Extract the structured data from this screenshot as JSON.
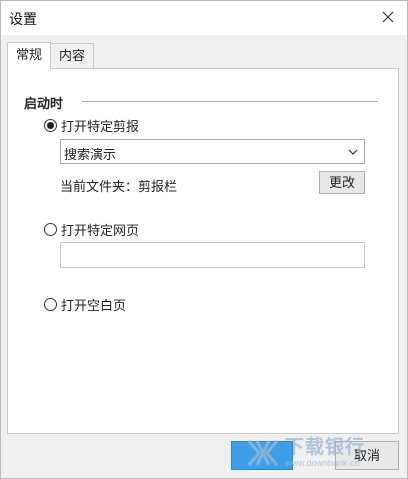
{
  "window": {
    "title": "设置"
  },
  "tabs": [
    {
      "label": "常规",
      "active": true
    },
    {
      "label": "内容",
      "active": false
    }
  ],
  "startup": {
    "section_title": "启动时",
    "options": [
      {
        "label": "打开特定剪报",
        "checked": true
      },
      {
        "label": "打开特定网页",
        "checked": false
      },
      {
        "label": "打开空白页",
        "checked": false
      }
    ],
    "clip_select": {
      "value": "搜索演示"
    },
    "folder_label": "当前文件夹：剪报栏",
    "change_button": "更改",
    "url_input": {
      "value": "",
      "placeholder": ""
    }
  },
  "footer": {
    "cancel_button": "取消"
  },
  "watermark": {
    "main": "下载银行",
    "sub": "www.downbank.cn"
  },
  "colors": {
    "ok_button": "#3d9fe8",
    "dialog_bg": "#f0f0f0",
    "panel_bg": "#ffffff"
  },
  "icons": {
    "close": "close-icon",
    "dropdown": "chevron-down-icon",
    "watermark_logo": "downbank-logo-icon"
  }
}
